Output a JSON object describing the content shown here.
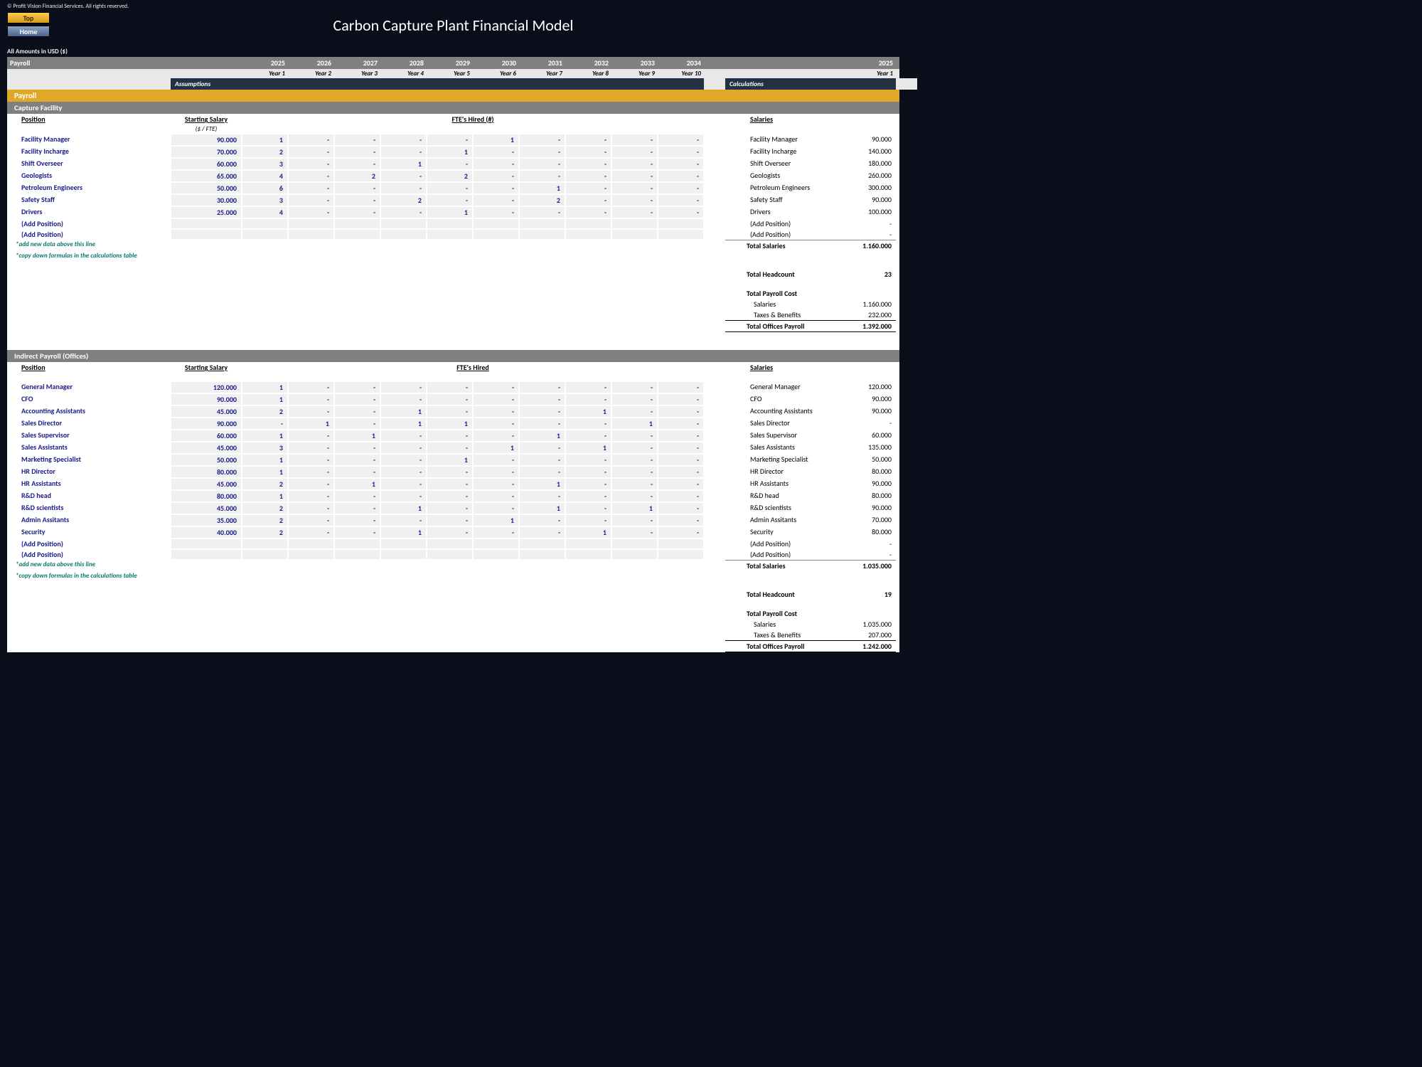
{
  "copyright": "© Profit Vision Financial Services. All rights reserved.",
  "buttons": {
    "top": "Top",
    "home": "Home"
  },
  "title": "Carbon Capture Plant Financial Model",
  "currency_note": "All Amounts in  USD ($)",
  "section_left": "Payroll",
  "years": [
    "2025",
    "2026",
    "2027",
    "2028",
    "2029",
    "2030",
    "2031",
    "2032",
    "2033",
    "2034"
  ],
  "year_labels": [
    "Year 1",
    "Year 2",
    "Year 3",
    "Year 4",
    "Year 5",
    "Year 6",
    "Year 7",
    "Year 8",
    "Year 9",
    "Year 10"
  ],
  "calc_year": "2025",
  "calc_year_label": "Year 1",
  "bar_assumptions": "Assumptions",
  "bar_calculations": "Calculations",
  "gold_stripe": "Payroll",
  "col_headers": {
    "position": "Position",
    "salary": "Starting Salary",
    "fte": "FTE's Hired (#)",
    "fte2": "FTE's Hired",
    "salaries": "Salaries",
    "unit": "($ / FTE)"
  },
  "notes": {
    "add": "*add new data above this line",
    "copy": "*copy down formulas in the calculations table"
  },
  "facility": {
    "title": "Capture Facility",
    "rows": [
      {
        "name": "Facility Manager",
        "salary": "90.000",
        "fte": [
          "1",
          "-",
          "-",
          "-",
          "-",
          "1",
          "-",
          "-",
          "-",
          "-"
        ],
        "calc": "90.000"
      },
      {
        "name": "Facility Incharge",
        "salary": "70.000",
        "fte": [
          "2",
          "-",
          "-",
          "-",
          "1",
          "-",
          "-",
          "-",
          "-",
          "-"
        ],
        "calc": "140.000"
      },
      {
        "name": "Shift Overseer",
        "salary": "60.000",
        "fte": [
          "3",
          "-",
          "-",
          "1",
          "-",
          "-",
          "-",
          "-",
          "-",
          "-"
        ],
        "calc": "180.000"
      },
      {
        "name": "Geologists",
        "salary": "65.000",
        "fte": [
          "4",
          "-",
          "2",
          "-",
          "2",
          "-",
          "-",
          "-",
          "-",
          "-"
        ],
        "calc": "260.000"
      },
      {
        "name": "Petroleum Engineers",
        "salary": "50.000",
        "fte": [
          "6",
          "-",
          "-",
          "-",
          "-",
          "-",
          "1",
          "-",
          "-",
          "-"
        ],
        "calc": "300.000"
      },
      {
        "name": "Safety Staff",
        "salary": "30.000",
        "fte": [
          "3",
          "-",
          "-",
          "2",
          "-",
          "-",
          "2",
          "-",
          "-",
          "-"
        ],
        "calc": "90.000"
      },
      {
        "name": "Drivers",
        "salary": "25.000",
        "fte": [
          "4",
          "-",
          "-",
          "-",
          "1",
          "-",
          "-",
          "-",
          "-",
          "-"
        ],
        "calc": "100.000"
      },
      {
        "name": "(Add Position)",
        "salary": "",
        "fte": [
          "",
          "",
          "",
          "",
          "",
          "",
          "",
          "",
          "",
          ""
        ],
        "calc": "-"
      },
      {
        "name": "(Add Position)",
        "salary": "",
        "fte": [
          "",
          "",
          "",
          "",
          "",
          "",
          "",
          "",
          "",
          ""
        ],
        "calc": "-"
      }
    ],
    "totals": {
      "salaries": {
        "label": "Total Salaries",
        "value": "1.160.000"
      },
      "headcount": {
        "label": "Total Headcount",
        "value": "23"
      },
      "payroll_cost": {
        "label": "Total Payroll Cost"
      },
      "salaries_line": {
        "label": "Salaries",
        "value": "1.160.000"
      },
      "taxes": {
        "label": "Taxes & Benefits",
        "value": "232.000"
      },
      "total_offices": {
        "label": "Total Offices Payroll",
        "value": "1.392.000"
      }
    }
  },
  "indirect": {
    "title": "Indirect Payroll (Offices)",
    "rows": [
      {
        "name": "General Manager",
        "salary": "120.000",
        "fte": [
          "1",
          "-",
          "-",
          "-",
          "-",
          "-",
          "-",
          "-",
          "-",
          "-"
        ],
        "calc": "120.000"
      },
      {
        "name": "CFO",
        "salary": "90.000",
        "fte": [
          "1",
          "-",
          "-",
          "-",
          "-",
          "-",
          "-",
          "-",
          "-",
          "-"
        ],
        "calc": "90.000"
      },
      {
        "name": "Accounting Assistants",
        "salary": "45.000",
        "fte": [
          "2",
          "-",
          "-",
          "1",
          "-",
          "-",
          "-",
          "1",
          "-",
          "-"
        ],
        "calc": "90.000"
      },
      {
        "name": "Sales Director",
        "salary": "90.000",
        "fte": [
          "-",
          "1",
          "-",
          "1",
          "1",
          "-",
          "-",
          "-",
          "1",
          "-"
        ],
        "calc": "-"
      },
      {
        "name": "Sales Supervisor",
        "salary": "60.000",
        "fte": [
          "1",
          "-",
          "1",
          "-",
          "-",
          "-",
          "1",
          "-",
          "-",
          "-"
        ],
        "calc": "60.000"
      },
      {
        "name": "Sales Assistants",
        "salary": "45.000",
        "fte": [
          "3",
          "-",
          "-",
          "-",
          "-",
          "1",
          "-",
          "1",
          "-",
          "-"
        ],
        "calc": "135.000"
      },
      {
        "name": "Marketing Specialist",
        "salary": "50.000",
        "fte": [
          "1",
          "-",
          "-",
          "-",
          "1",
          "-",
          "-",
          "-",
          "-",
          "-"
        ],
        "calc": "50.000"
      },
      {
        "name": "HR Director",
        "salary": "80.000",
        "fte": [
          "1",
          "-",
          "-",
          "-",
          "-",
          "-",
          "-",
          "-",
          "-",
          "-"
        ],
        "calc": "80.000"
      },
      {
        "name": "HR Assistants",
        "salary": "45.000",
        "fte": [
          "2",
          "-",
          "1",
          "-",
          "-",
          "-",
          "1",
          "-",
          "-",
          "-"
        ],
        "calc": "90.000"
      },
      {
        "name": "R&D head",
        "salary": "80.000",
        "fte": [
          "1",
          "-",
          "-",
          "-",
          "-",
          "-",
          "-",
          "-",
          "-",
          "-"
        ],
        "calc": "80.000"
      },
      {
        "name": "R&D scientists",
        "salary": "45.000",
        "fte": [
          "2",
          "-",
          "-",
          "1",
          "-",
          "-",
          "1",
          "-",
          "1",
          "-"
        ],
        "calc": "90.000"
      },
      {
        "name": "Admin Assitants",
        "salary": "35.000",
        "fte": [
          "2",
          "-",
          "-",
          "-",
          "-",
          "1",
          "-",
          "-",
          "-",
          "-"
        ],
        "calc": "70.000"
      },
      {
        "name": "Security",
        "salary": "40.000",
        "fte": [
          "2",
          "-",
          "-",
          "1",
          "-",
          "-",
          "-",
          "1",
          "-",
          "-"
        ],
        "calc": "80.000"
      },
      {
        "name": "(Add Position)",
        "salary": "",
        "fte": [
          "",
          "",
          "",
          "",
          "",
          "",
          "",
          "",
          "",
          ""
        ],
        "calc": "-"
      },
      {
        "name": "(Add Position)",
        "salary": "",
        "fte": [
          "",
          "",
          "",
          "",
          "",
          "",
          "",
          "",
          "",
          ""
        ],
        "calc": "-"
      }
    ],
    "totals": {
      "salaries": {
        "label": "Total Salaries",
        "value": "1.035.000"
      },
      "headcount": {
        "label": "Total Headcount",
        "value": "19"
      },
      "payroll_cost": {
        "label": "Total Payroll Cost"
      },
      "salaries_line": {
        "label": "Salaries",
        "value": "1.035.000"
      },
      "taxes": {
        "label": "Taxes & Benefits",
        "value": "207.000"
      },
      "total_offices": {
        "label": "Total Offices Payroll",
        "value": "1.242.000"
      }
    }
  }
}
